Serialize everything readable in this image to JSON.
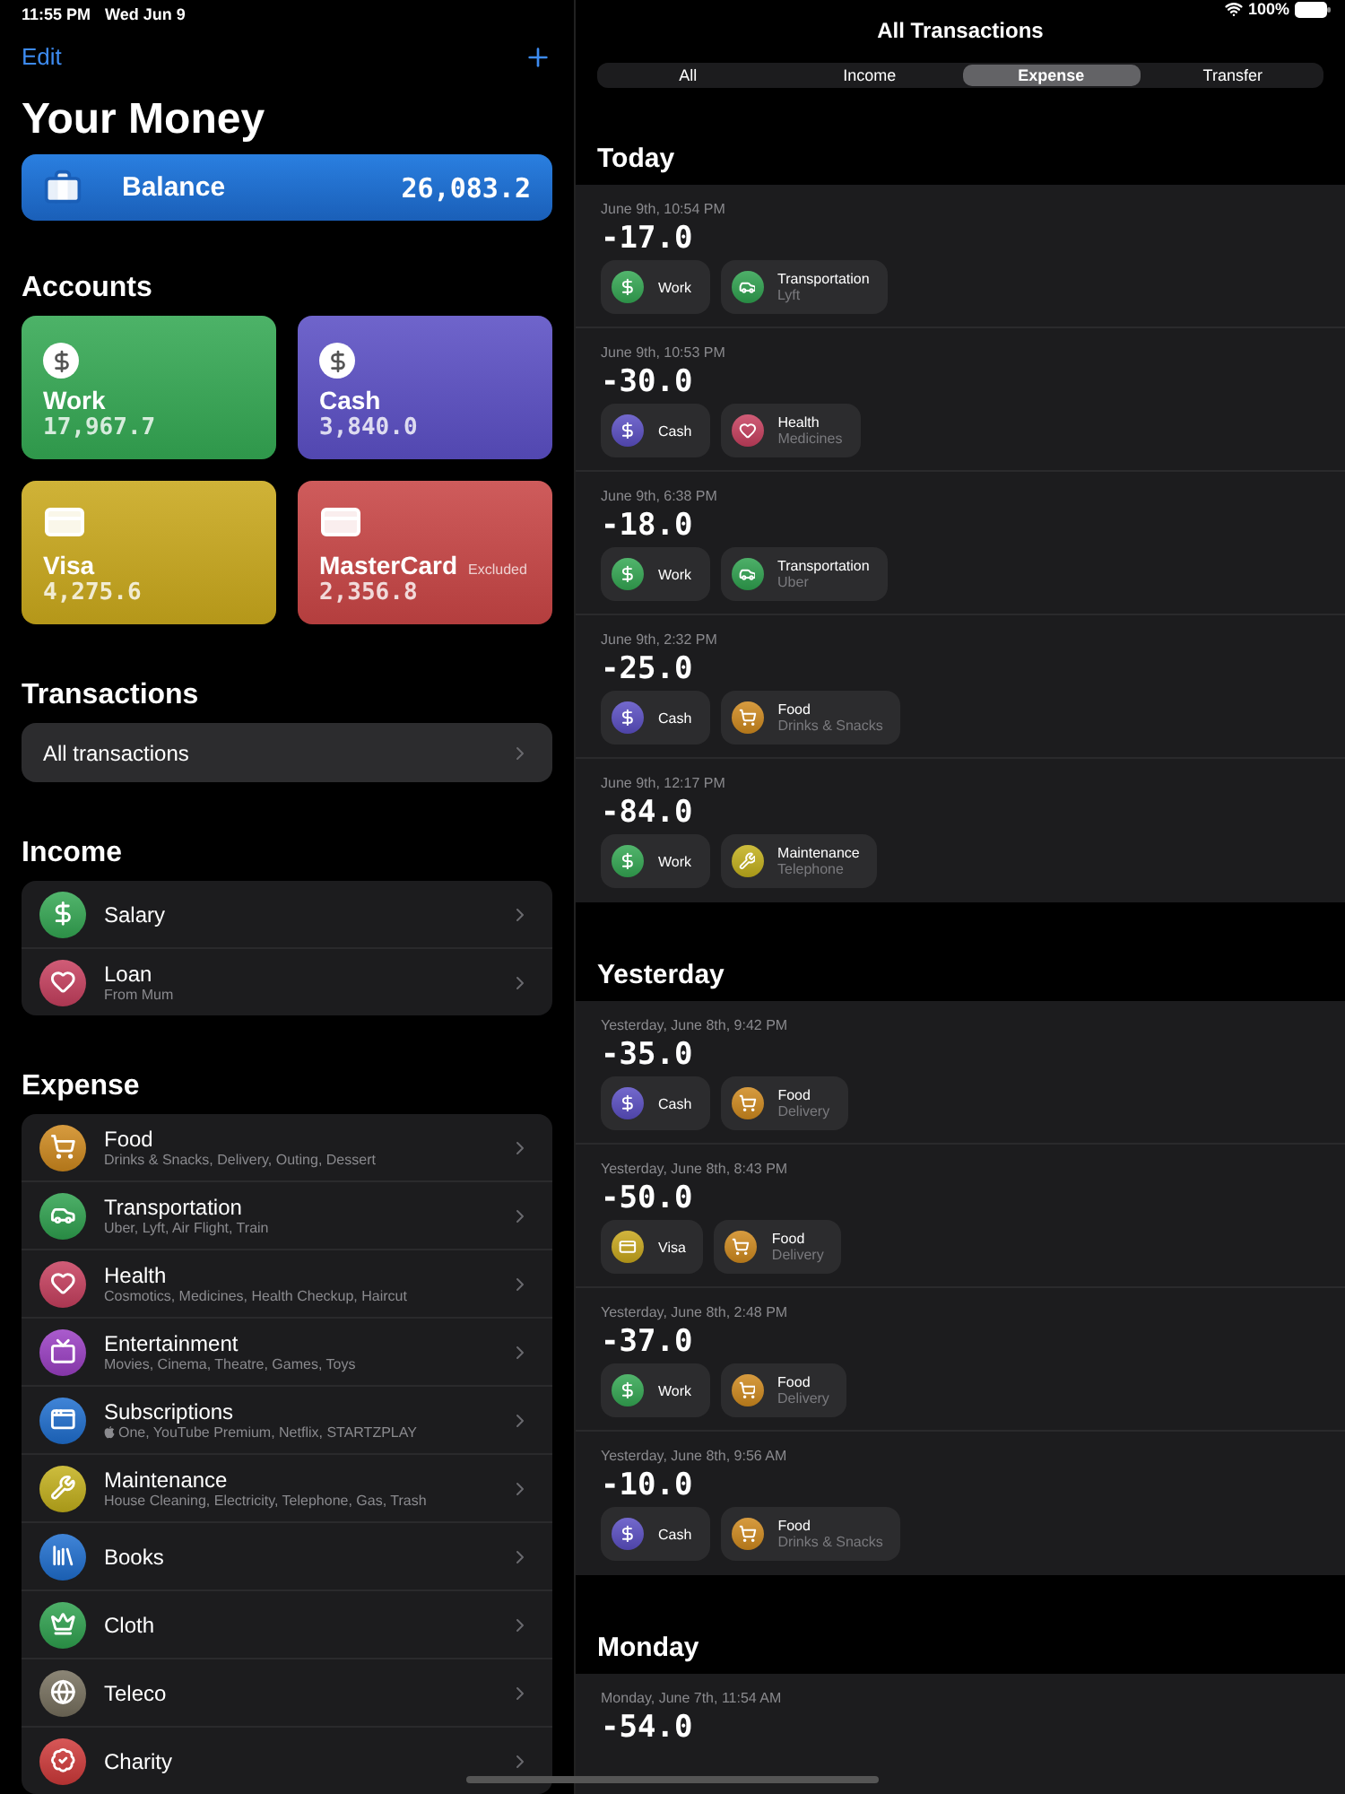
{
  "status_bar": {
    "time": "11:55 PM",
    "date": "Wed Jun 9",
    "battery": "100%"
  },
  "sidebar": {
    "edit_button": "Edit",
    "title": "Your Money",
    "balance": {
      "label": "Balance",
      "amount": "26,083.2"
    },
    "accounts_heading": "Accounts",
    "accounts": [
      {
        "kind": "dollar",
        "name": "Work",
        "amount": "17,967.7",
        "color": "#34a853"
      },
      {
        "kind": "dollar",
        "name": "Cash",
        "amount": "3,840.0",
        "color": "#5b4fc4"
      },
      {
        "kind": "card",
        "name": "Visa",
        "amount": "4,275.6",
        "color": "#c9a81c"
      },
      {
        "kind": "card",
        "note": "Excluded",
        "name": "MasterCard",
        "amount": "2,356.8",
        "color": "#c84545"
      }
    ],
    "transactions_heading": "Transactions",
    "transactions_link": "All transactions",
    "income_heading": "Income",
    "income": [
      {
        "kind": "dollar",
        "name": "Salary",
        "color": "#34a853"
      },
      {
        "kind": "heart",
        "name": "Loan",
        "subtitle": "From Mum",
        "color": "#c8405f"
      }
    ],
    "expense_heading": "Expense",
    "expense": [
      {
        "kind": "cart",
        "name": "Food",
        "subtitle": "Drinks & Snacks, Delivery, Outing, Dessert",
        "color": "#d08a1e"
      },
      {
        "kind": "car",
        "name": "Transportation",
        "subtitle": "Uber, Lyft, Air Flight, Train",
        "color": "#2fa24f"
      },
      {
        "kind": "heart",
        "name": "Health",
        "subtitle": "Cosmotics, Medicines, Health Checkup, Haircut",
        "color": "#c8405f"
      },
      {
        "kind": "tv",
        "name": "Entertainment",
        "subtitle": "Movies, Cinema, Theatre, Games, Toys",
        "color": "#9b3fc4"
      },
      {
        "kind": "window",
        "name": "Subscriptions",
        "subtitle": "One, YouTube Premium, Netflix, STARTZPLAY",
        "lead_logo": true,
        "color": "#1f6fd0"
      },
      {
        "kind": "wrench",
        "name": "Maintenance",
        "subtitle": "House Cleaning, Electricity, Telephone, Gas, Trash",
        "color": "#c4b11c"
      },
      {
        "kind": "books",
        "name": "Books",
        "color": "#1f6fd0"
      },
      {
        "kind": "crown",
        "name": "Cloth",
        "color": "#2fa24f"
      },
      {
        "kind": "globe",
        "name": "Teleco",
        "color": "#77705e"
      },
      {
        "kind": "badge",
        "name": "Charity",
        "color": "#d03a3a"
      }
    ]
  },
  "detail": {
    "title": "All Transactions",
    "tabs": [
      {
        "label": "All",
        "selected": false
      },
      {
        "label": "Income",
        "selected": false
      },
      {
        "label": "Expense",
        "selected": true
      },
      {
        "label": "Transfer",
        "selected": false
      }
    ],
    "groups": [
      {
        "heading": "Today",
        "items": [
          {
            "date": "June 9th, 10:54 PM",
            "amount": "-17.0",
            "account": {
              "kind": "dollar",
              "name": "Work",
              "color": "#34a853"
            },
            "category": {
              "kind": "car",
              "name": "Transportation",
              "subtitle": "Lyft",
              "color": "#2fa24f"
            }
          },
          {
            "date": "June 9th, 10:53 PM",
            "amount": "-30.0",
            "account": {
              "kind": "dollar",
              "name": "Cash",
              "color": "#5b4fc4"
            },
            "category": {
              "kind": "heart",
              "name": "Health",
              "subtitle": "Medicines",
              "color": "#c8405f"
            }
          },
          {
            "date": "June 9th, 6:38 PM",
            "amount": "-18.0",
            "account": {
              "kind": "dollar",
              "name": "Work",
              "color": "#34a853"
            },
            "category": {
              "kind": "car",
              "name": "Transportation",
              "subtitle": "Uber",
              "color": "#2fa24f"
            }
          },
          {
            "date": "June 9th, 2:32 PM",
            "amount": "-25.0",
            "account": {
              "kind": "dollar",
              "name": "Cash",
              "color": "#5b4fc4"
            },
            "category": {
              "kind": "cart",
              "name": "Food",
              "subtitle": "Drinks & Snacks",
              "color": "#d08a1e"
            }
          },
          {
            "date": "June 9th, 12:17 PM",
            "amount": "-84.0",
            "account": {
              "kind": "dollar",
              "name": "Work",
              "color": "#34a853"
            },
            "category": {
              "kind": "wrench",
              "name": "Maintenance",
              "subtitle": "Telephone",
              "color": "#c4b11c"
            }
          }
        ]
      },
      {
        "heading": "Yesterday",
        "items": [
          {
            "date": "Yesterday, June 8th, 9:42 PM",
            "amount": "-35.0",
            "account": {
              "kind": "dollar",
              "name": "Cash",
              "color": "#5b4fc4"
            },
            "category": {
              "kind": "cart",
              "name": "Food",
              "subtitle": "Delivery",
              "color": "#d08a1e"
            }
          },
          {
            "date": "Yesterday, June 8th, 8:43 PM",
            "amount": "-50.0",
            "account": {
              "kind": "card",
              "name": "Visa",
              "color": "#c9a81c"
            },
            "category": {
              "kind": "cart",
              "name": "Food",
              "subtitle": "Delivery",
              "color": "#d08a1e"
            }
          },
          {
            "date": "Yesterday, June 8th, 2:48 PM",
            "amount": "-37.0",
            "account": {
              "kind": "dollar",
              "name": "Work",
              "color": "#34a853"
            },
            "category": {
              "kind": "cart",
              "name": "Food",
              "subtitle": "Delivery",
              "color": "#d08a1e"
            }
          },
          {
            "date": "Yesterday, June 8th, 9:56 AM",
            "amount": "-10.0",
            "account": {
              "kind": "dollar",
              "name": "Cash",
              "color": "#5b4fc4"
            },
            "category": {
              "kind": "cart",
              "name": "Food",
              "subtitle": "Drinks & Snacks",
              "color": "#d08a1e"
            }
          }
        ]
      },
      {
        "heading": "Monday",
        "items": [
          {
            "date": "Monday, June 7th, 11:54 AM",
            "amount": "-54.0"
          }
        ]
      }
    ]
  }
}
